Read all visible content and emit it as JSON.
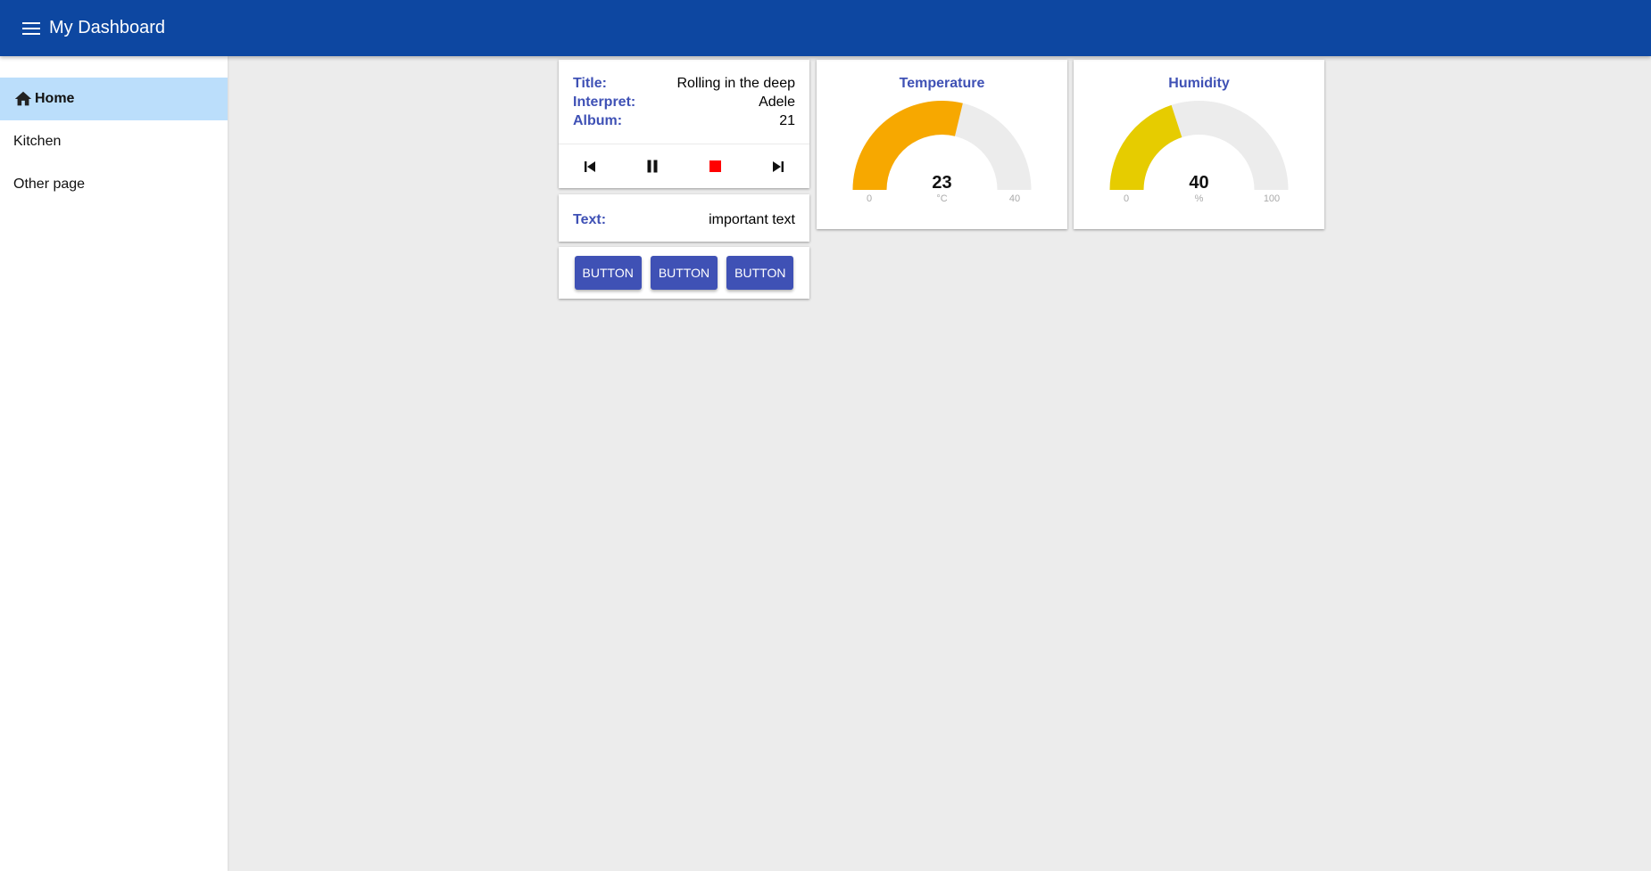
{
  "header": {
    "title": "My Dashboard",
    "menu_icon": "menu-icon"
  },
  "sidebar": {
    "items": [
      {
        "label": "Home",
        "icon": "home-icon",
        "active": true
      },
      {
        "label": "Kitchen",
        "active": false
      },
      {
        "label": "Other page",
        "active": false
      }
    ]
  },
  "media": {
    "title_label": "Title:",
    "title_value": "Rolling in the deep",
    "interpret_label": "Interpret:",
    "interpret_value": "Adele",
    "album_label": "Album:",
    "album_value": "21",
    "controls": [
      "skip-previous-icon",
      "pause-icon",
      "stop-icon",
      "skip-next-icon"
    ]
  },
  "text_card": {
    "label": "Text:",
    "value": "important text"
  },
  "buttons": [
    "BUTTON",
    "BUTTON",
    "BUTTON"
  ],
  "gauges": {
    "temperature": {
      "title": "Temperature",
      "value": 23,
      "unit": "°C",
      "min": 0,
      "max": 40,
      "color": "#f7a800"
    },
    "humidity": {
      "title": "Humidity",
      "value": 40,
      "unit": "%",
      "min": 0,
      "max": 100,
      "color": "#e6cc00"
    }
  },
  "colors": {
    "appbar": "#0d47a1",
    "accent": "#3f51b5",
    "active_nav": "#bbdefb",
    "stop": "#ff0000",
    "gauge_track": "#ececec"
  }
}
